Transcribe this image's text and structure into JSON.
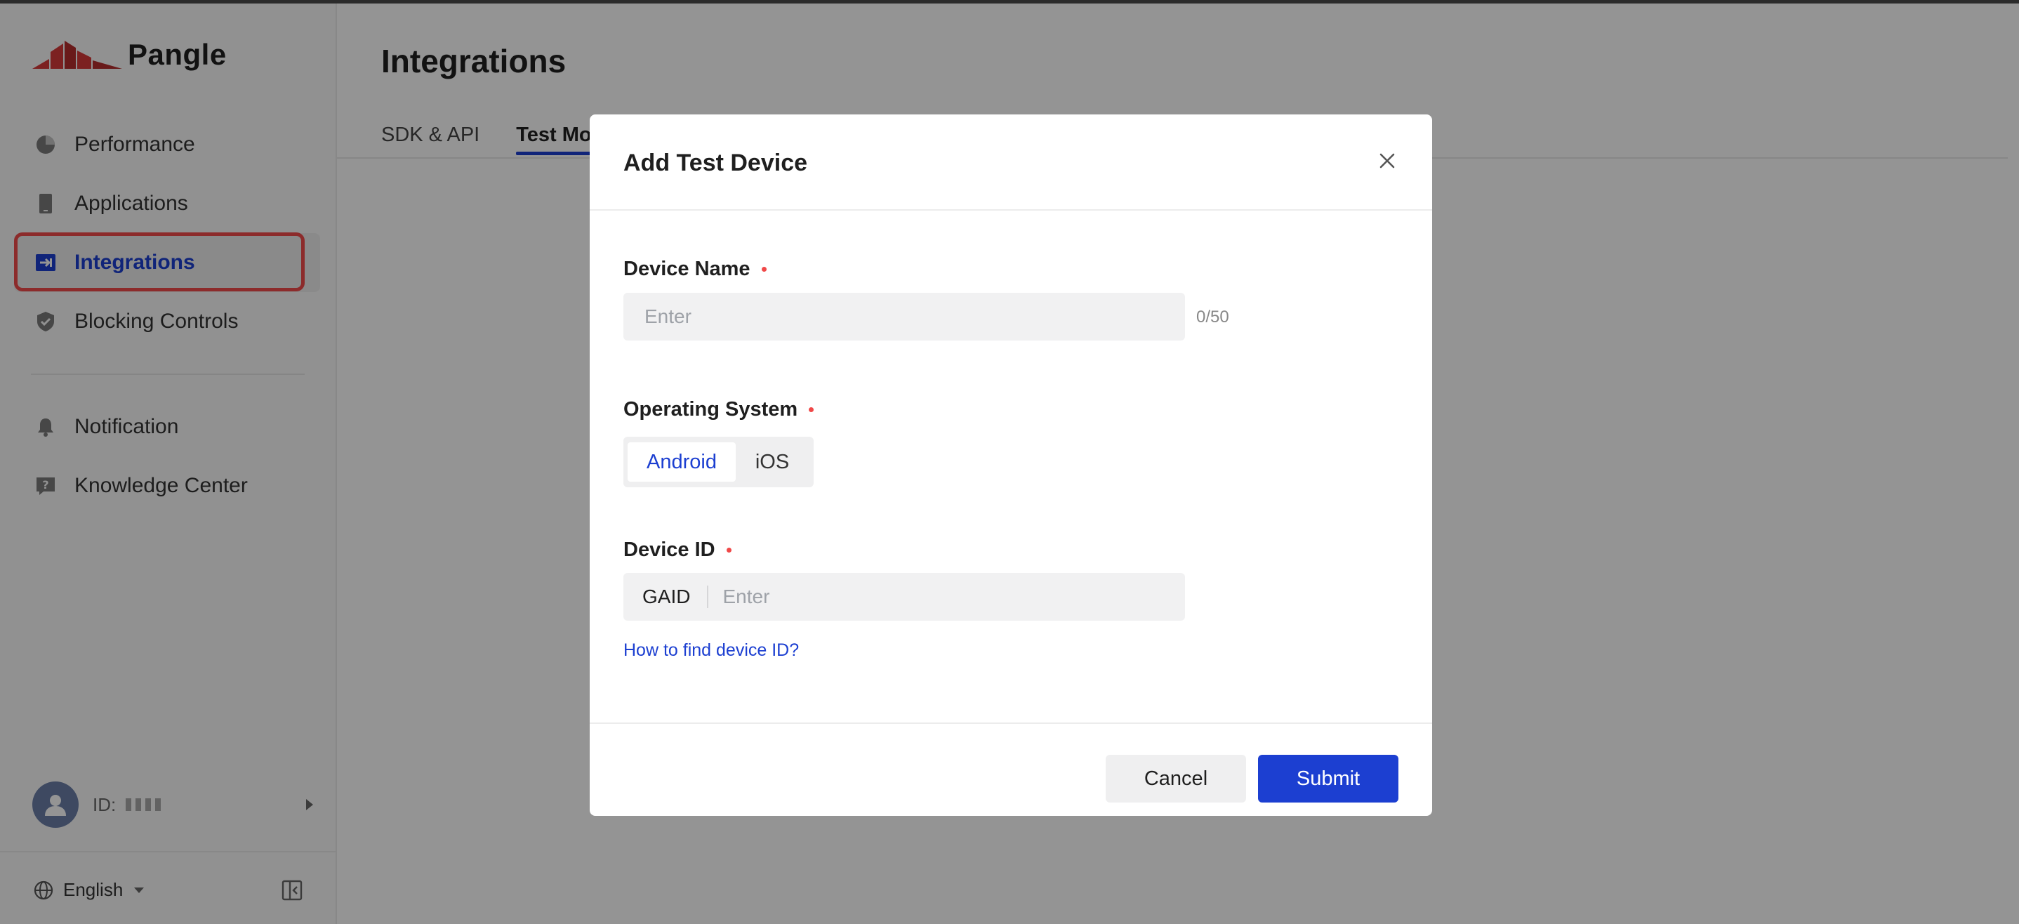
{
  "app": {
    "brand": "Pangle"
  },
  "sidebar": {
    "items": [
      {
        "label": "Performance",
        "icon": "pie-chart-icon"
      },
      {
        "label": "Applications",
        "icon": "phone-icon"
      },
      {
        "label": "Integrations",
        "icon": "integration-icon",
        "active": true
      },
      {
        "label": "Blocking Controls",
        "icon": "shield-icon"
      },
      {
        "label": "Notification",
        "icon": "bell-icon"
      },
      {
        "label": "Knowledge Center",
        "icon": "help-icon"
      }
    ],
    "user": {
      "id_label": "ID:"
    },
    "language": "English"
  },
  "main": {
    "title": "Integrations",
    "tabs": [
      {
        "label": "SDK & API"
      },
      {
        "label": "Test Mode",
        "active": true
      }
    ]
  },
  "modal": {
    "title": "Add Test Device",
    "device_name": {
      "label": "Device Name",
      "placeholder": "Enter",
      "counter": "0/50"
    },
    "operating_system": {
      "label": "Operating System",
      "options": [
        "Android",
        "iOS"
      ],
      "selected": "Android"
    },
    "device_id": {
      "label": "Device ID",
      "prefix": "GAID",
      "placeholder": "Enter"
    },
    "help_link": "How to find device ID?",
    "cancel_label": "Cancel",
    "submit_label": "Submit"
  },
  "colors": {
    "accent": "#1c3fd1",
    "required": "#f04848",
    "highlight": "#f24a4a",
    "brand_red": "#d63a3a"
  }
}
